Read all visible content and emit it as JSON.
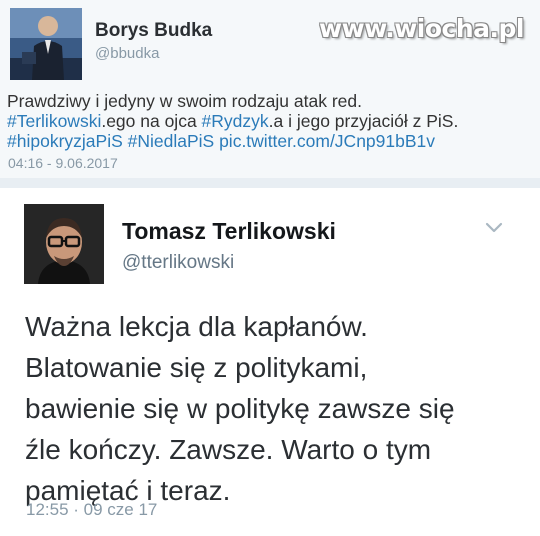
{
  "watermark": "www.wiocha.pl",
  "outer_tweet": {
    "author_name": "Borys Budka",
    "author_handle": "@bbudka",
    "line1": "Prawdziwy i jedyny w swoim rodzaju atak red.",
    "line2": [
      {
        "text": "#Terlikowski",
        "tag": true
      },
      {
        "text": ".ego na ojca ",
        "tag": false
      },
      {
        "text": "#Rydzyk",
        "tag": true
      },
      {
        "text": ".a i jego przyjaciół z PiS.",
        "tag": false
      }
    ],
    "line3": [
      {
        "text": "#hipokryzjaPiS",
        "tag": true
      },
      {
        "text": " ",
        "tag": false
      },
      {
        "text": "#NiedlaPiS",
        "tag": true
      },
      {
        "text": " ",
        "tag": false
      },
      {
        "text": "pic.twitter.com/JCnp91bB1v",
        "tag": true
      }
    ],
    "timestamp": "04:16 - 9.06.2017"
  },
  "inner_tweet": {
    "author_name": "Tomasz Terlikowski",
    "author_handle": "@tterlikowski",
    "lines": [
      "Ważna lekcja dla kapłanów.",
      "Blatowanie się z politykami,",
      "bawienie się w politykę zawsze się",
      "źle kończy. Zawsze. Warto o tym",
      "pamiętać i teraz."
    ],
    "timestamp": "12:55 · 09 cze 17"
  },
  "colors": {
    "link": "#2b7bb9",
    "muted": "#8899a6",
    "text": "#2b2f33"
  },
  "icons": {
    "menu": "chevron-down-icon"
  }
}
